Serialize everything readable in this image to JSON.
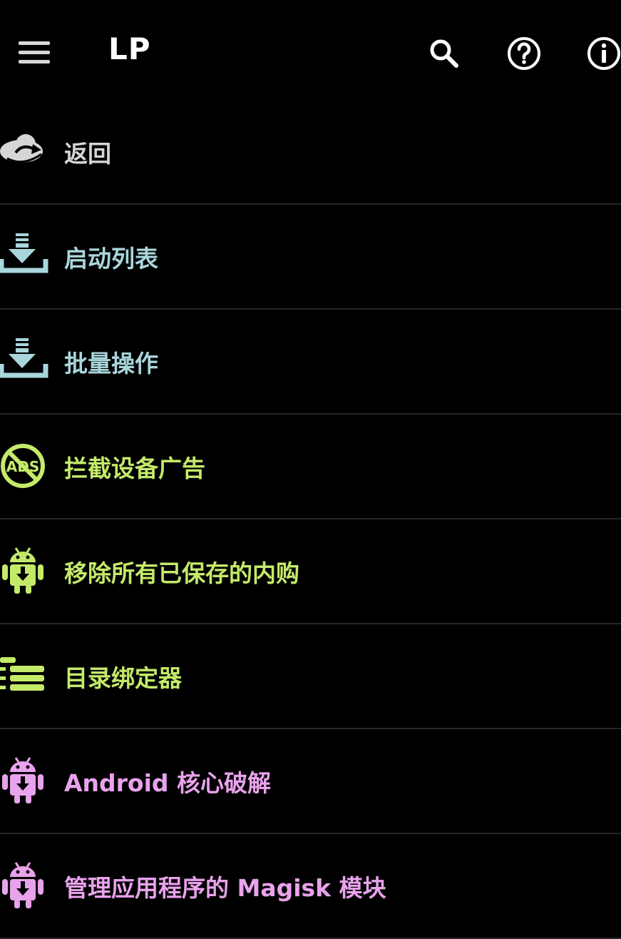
{
  "toolbar": {
    "title": "LP",
    "menu_icon": "hamburger-menu-icon",
    "actions": [
      {
        "icon": "search-icon"
      },
      {
        "icon": "help-circle-icon"
      },
      {
        "icon": "info-circle-icon"
      }
    ]
  },
  "colors": {
    "background": "#000000",
    "divider": "#262626",
    "gray": "#d6d6d6",
    "cyan": "#a9d6dc",
    "green": "#c4ea6a",
    "pink": "#e9a2ec"
  },
  "menu": {
    "items": [
      {
        "label": "返回",
        "icon": "back-cloud-icon",
        "color": "#d6d6d6"
      },
      {
        "label": "启动列表",
        "icon": "download-tray-icon",
        "color": "#a9d6dc"
      },
      {
        "label": "批量操作",
        "icon": "download-tray-icon",
        "color": "#a9d6dc"
      },
      {
        "label": "拦截设备广告",
        "icon": "no-ads-icon",
        "color": "#c4ea6a"
      },
      {
        "label": "移除所有已保存的内购",
        "icon": "android-download-icon",
        "color": "#c4ea6a"
      },
      {
        "label": "目录绑定器",
        "icon": "stacked-bars-icon",
        "color": "#c4ea6a"
      },
      {
        "label": "Android 核心破解",
        "icon": "android-download-icon",
        "color": "#e9a2ec"
      },
      {
        "label": "管理应用程序的 Magisk 模块",
        "icon": "android-download-icon",
        "color": "#e9a2ec"
      }
    ]
  }
}
